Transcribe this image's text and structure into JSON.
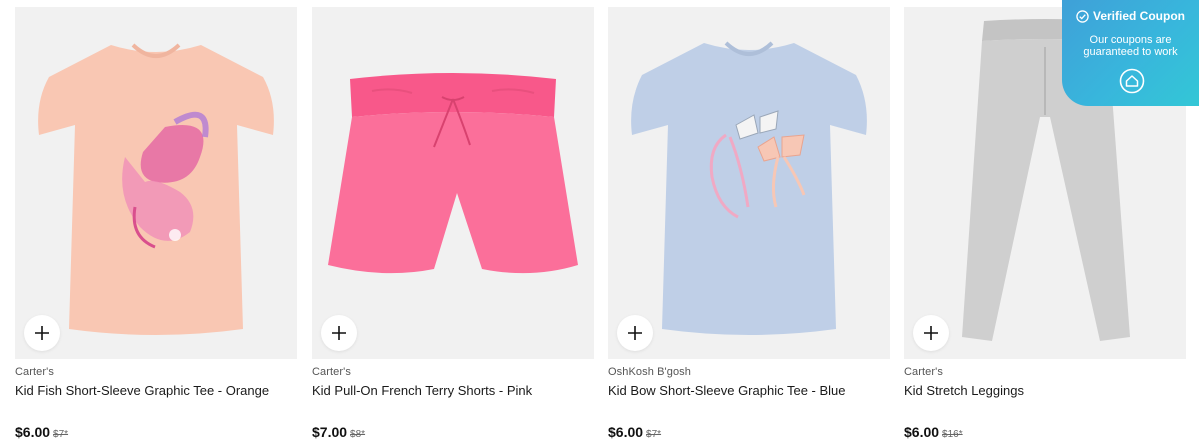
{
  "products": [
    {
      "brand": "Carter's",
      "name": "Kid Fish Short-Sleeve Graphic Tee - Orange",
      "price": "$6.00",
      "old_price": "$7*",
      "image_icon": "orange-fish-tee-image",
      "colors": {
        "main": "#f9c7b3",
        "accent": "#e56aa3"
      }
    },
    {
      "brand": "Carter's",
      "name": "Kid Pull-On French Terry Shorts - Pink",
      "price": "$7.00",
      "old_price": "$8*",
      "image_icon": "pink-shorts-image",
      "colors": {
        "main": "#fb6f9a",
        "accent": "#e9507e"
      }
    },
    {
      "brand": "OshKosh B'gosh",
      "name": "Kid Bow Short-Sleeve Graphic Tee - Blue",
      "price": "$6.00",
      "old_price": "$7*",
      "image_icon": "blue-bow-tee-image",
      "colors": {
        "main": "#bfcfe7",
        "accent": "#f0a9c4"
      }
    },
    {
      "brand": "Carter's",
      "name": "Kid Stretch Leggings",
      "price": "$6.00",
      "old_price": "$16*",
      "image_icon": "gray-leggings-image",
      "colors": {
        "main": "#cfcfcf",
        "accent": "#b8b8b8"
      }
    }
  ],
  "add_button_icon": "plus-icon",
  "coupon_badge": {
    "title": "Verified Coupon",
    "line1": "Our coupons are",
    "line2": "guaranteed to work",
    "title_icon": "check-circle-icon",
    "logo_icon": "house-logo-icon",
    "colors": {
      "start": "#3fa0d8",
      "end": "#33c7d6"
    }
  }
}
